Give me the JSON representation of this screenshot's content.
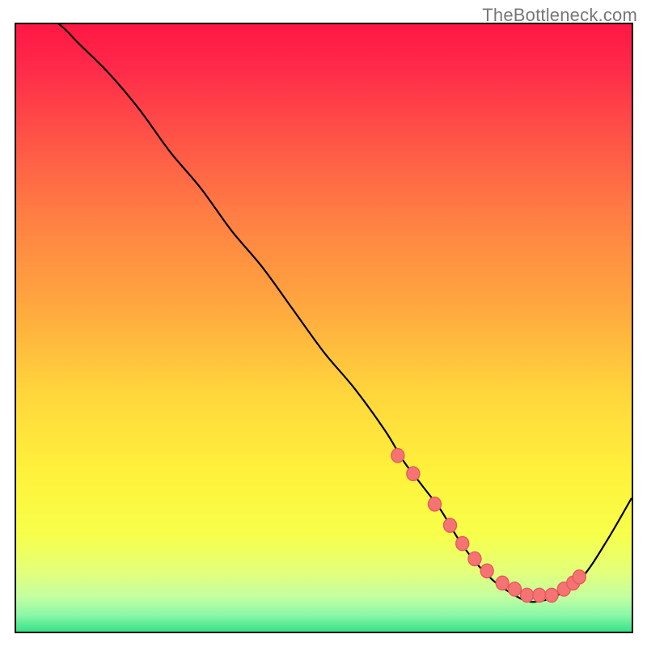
{
  "attribution": "TheBottleneck.com",
  "chart_data": {
    "type": "line",
    "title": "",
    "xlabel": "",
    "ylabel": "",
    "xlim": [
      0,
      100
    ],
    "ylim": [
      0,
      100
    ],
    "series": [
      {
        "name": "bottleneck-curve",
        "x": [
          0,
          7,
          10,
          15,
          20,
          25,
          30,
          35,
          40,
          45,
          50,
          55,
          60,
          63,
          66,
          69,
          72,
          75,
          78,
          81,
          83,
          85,
          88,
          92,
          96,
          100
        ],
        "y": [
          105,
          100,
          97,
          92,
          86,
          79,
          73,
          66,
          60,
          53,
          46,
          40,
          33,
          28,
          24,
          20,
          15,
          11,
          8,
          6,
          5,
          5,
          6,
          9,
          15,
          22
        ]
      }
    ],
    "markers": {
      "name": "bottleneck-points",
      "x": [
        62,
        64.5,
        68,
        70.5,
        72.5,
        74.5,
        76.5,
        79,
        81,
        83,
        85,
        87,
        89,
        90.5,
        91.5
      ],
      "y": [
        29,
        26,
        21,
        17.5,
        14.5,
        12,
        10,
        8,
        7,
        6,
        6,
        6,
        7,
        8,
        9
      ]
    },
    "gradient_stops": [
      {
        "offset": 0.0,
        "color": "#ff1744"
      },
      {
        "offset": 0.07,
        "color": "#ff2a4a"
      },
      {
        "offset": 0.17,
        "color": "#ff4e47"
      },
      {
        "offset": 0.3,
        "color": "#ff7b44"
      },
      {
        "offset": 0.45,
        "color": "#ffa53f"
      },
      {
        "offset": 0.6,
        "color": "#ffd63c"
      },
      {
        "offset": 0.73,
        "color": "#fff23b"
      },
      {
        "offset": 0.83,
        "color": "#f7ff4a"
      },
      {
        "offset": 0.89,
        "color": "#e3ff7a"
      },
      {
        "offset": 0.93,
        "color": "#c4ffa0"
      },
      {
        "offset": 0.96,
        "color": "#8bf7a8"
      },
      {
        "offset": 0.985,
        "color": "#3de38a"
      },
      {
        "offset": 1.0,
        "color": "#20d87c"
      }
    ],
    "colors": {
      "curve": "#000000",
      "marker_fill": "#f57373",
      "marker_stroke": "#e55a5a"
    }
  }
}
